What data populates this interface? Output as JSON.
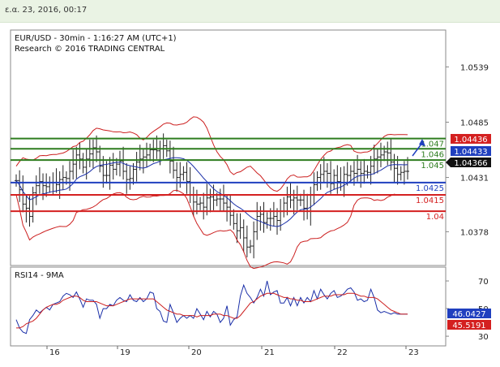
{
  "header": {
    "timestamp": "ε.α. 23, 2016, 00:17"
  },
  "chart_data": [
    {
      "type": "candlestick",
      "title": "EUR/USD - 30min - 1:16:27 AM (UTC+1)",
      "subtitle": "Research © 2016 TRADING CENTRAL",
      "x_tick_labels": [
        "16",
        "19",
        "20",
        "21",
        "22",
        "23"
      ],
      "y_ticks": [
        1.0539,
        1.0485,
        1.0431,
        1.0378
      ],
      "ylim": [
        1.0345,
        1.0575
      ],
      "grid": false,
      "close_series": [
        1.0428,
        1.0419,
        1.0405,
        1.0401,
        1.0393,
        1.0416,
        1.0423,
        1.0427,
        1.0423,
        1.0422,
        1.0426,
        1.0426,
        1.0424,
        1.0429,
        1.0431,
        1.043,
        1.0437,
        1.0444,
        1.0453,
        1.0449,
        1.0441,
        1.0449,
        1.0454,
        1.046,
        1.0456,
        1.0442,
        1.0433,
        1.0433,
        1.0443,
        1.0439,
        1.0444,
        1.0447,
        1.0437,
        1.0429,
        1.043,
        1.0439,
        1.0446,
        1.0449,
        1.0451,
        1.0453,
        1.0458,
        1.0458,
        1.0457,
        1.0459,
        1.0462,
        1.0457,
        1.0447,
        1.0438,
        1.0431,
        1.0434,
        1.0436,
        1.0427,
        1.0414,
        1.0407,
        1.0405,
        1.0406,
        1.0402,
        1.0411,
        1.0412,
        1.0409,
        1.041,
        1.041,
        1.0406,
        1.0402,
        1.0394,
        1.0386,
        1.0379,
        1.0382,
        1.0372,
        1.0363,
        1.0364,
        1.0378,
        1.0393,
        1.0395,
        1.0387,
        1.0391,
        1.0391,
        1.0393,
        1.0389,
        1.0398,
        1.0406,
        1.0412,
        1.0409,
        1.0411,
        1.0409,
        1.0409,
        1.0401,
        1.0398,
        1.0414,
        1.0424,
        1.0431,
        1.0434,
        1.0437,
        1.0435,
        1.0425,
        1.0433,
        1.0427,
        1.0426,
        1.0434,
        1.0433,
        1.0437,
        1.0435,
        1.0439,
        1.0435,
        1.0437,
        1.0436,
        1.0442,
        1.0449,
        1.0451,
        1.0453,
        1.0456,
        1.0455,
        1.0446,
        1.044,
        1.0434,
        1.0436,
        1.0437,
        1.0437
      ],
      "last_price": "1.04366",
      "price_tags": [
        {
          "label": "1.04436",
          "color": "#d42020"
        },
        {
          "label": "1.04433",
          "color": "#1f3fbf"
        },
        {
          "label": "1.04366",
          "color": "#111111"
        }
      ],
      "levels": [
        {
          "label": "1.047",
          "value": 1.0469,
          "color": "#2e7d1f"
        },
        {
          "label": "1.046",
          "value": 1.0459,
          "color": "#2e7d1f"
        },
        {
          "label": "1.045",
          "value": 1.0448,
          "color": "#2e7d1f"
        },
        {
          "label": "1.0425",
          "value": 1.0426,
          "color": "#1f3fbf"
        },
        {
          "label": "1.0415",
          "value": 1.0414,
          "color": "#d42020"
        },
        {
          "label": "1.04",
          "value": 1.0398,
          "color": "#d42020"
        }
      ]
    },
    {
      "type": "line",
      "title": "RSI14 - 9MA",
      "y_ticks": [
        70,
        50,
        30
      ],
      "ylim": [
        23,
        80
      ],
      "series": [
        {
          "color": "#1a2fa8",
          "values": [
            42,
            36,
            33,
            32,
            42,
            45,
            49,
            47,
            49,
            51,
            49,
            53,
            54,
            55,
            59,
            61,
            60,
            58,
            62,
            57,
            51,
            57,
            56,
            56,
            53,
            43,
            50,
            50,
            53,
            52,
            56,
            58,
            56,
            55,
            60,
            56,
            55,
            58,
            55,
            57,
            62,
            61,
            50,
            48,
            41,
            40,
            53,
            47,
            40,
            43,
            45,
            43,
            45,
            43,
            50,
            46,
            42,
            48,
            44,
            48,
            46,
            40,
            43,
            52,
            38,
            42,
            44,
            59,
            67,
            61,
            58,
            54,
            58,
            64,
            59,
            70,
            60,
            62,
            63,
            54,
            54,
            58,
            52,
            58,
            52,
            58,
            54,
            58,
            55,
            63,
            57,
            64,
            60,
            57,
            61,
            63,
            58,
            59,
            61,
            64,
            65,
            62,
            56,
            57,
            55,
            56,
            64,
            58,
            49,
            47,
            48,
            47,
            46,
            47,
            46,
            46,
            46,
            46
          ]
        },
        {
          "color": "#cc1f1f",
          "values": [
            36,
            36,
            37,
            39,
            40,
            41,
            43,
            46,
            49,
            51,
            52,
            53,
            53,
            54,
            56,
            57,
            58,
            59,
            59,
            58,
            56,
            55,
            55,
            55,
            55,
            54,
            53,
            52,
            52,
            52,
            53,
            54,
            55,
            56,
            57,
            57,
            57,
            57,
            57,
            57,
            57,
            57,
            55,
            53,
            51,
            49,
            48,
            47,
            46,
            46,
            45,
            45,
            45,
            45,
            44,
            45,
            45,
            45,
            45,
            46,
            46,
            46,
            45,
            45,
            44,
            43,
            43,
            45,
            48,
            51,
            54,
            55,
            57,
            59,
            60,
            61,
            61,
            61,
            60,
            59,
            58,
            58,
            57,
            57,
            56,
            56,
            55,
            55,
            55,
            56,
            57,
            58,
            59,
            59,
            59,
            60,
            60,
            60,
            60,
            61,
            61,
            61,
            60,
            59,
            59,
            58,
            58,
            58,
            57,
            55,
            53,
            51,
            49,
            48,
            47,
            46,
            46,
            46
          ]
        }
      ],
      "price_tags": [
        {
          "label": "46.0427",
          "color": "#1f3fbf"
        },
        {
          "label": "45.5191",
          "color": "#d42020"
        }
      ]
    }
  ]
}
